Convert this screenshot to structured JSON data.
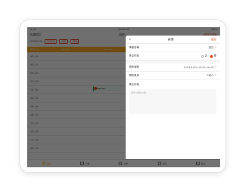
{
  "statusbar": {
    "time": "11:09",
    "date": "Tue Oct 10",
    "battery": "100%"
  },
  "navbar": {
    "left": "店铺首页",
    "title": "场地",
    "right": "+预约",
    "right2": "搜索"
  },
  "toolbar": {
    "date_label": "2023/10/10",
    "chip1": "日/周/月",
    "chip2": "设置",
    "chip3": "更多"
  },
  "grid_header": {
    "col_time": "时间/方式",
    "col_a": "Monday",
    "col_b": "Tuesday"
  },
  "time_slots": [
    "06 : 00",
    "08 : 30",
    "09 : 00",
    "10 : 30",
    "11 : 00",
    "12 : 00",
    "13 : 00",
    "14 : 00",
    "15 : 00",
    "16 : 00",
    "17 : 00",
    "18 : 00"
  ],
  "booking": {
    "label": "MR.LEE"
  },
  "tabs": [
    {
      "label": "首页"
    },
    {
      "label": "订单"
    },
    {
      "label": "会员"
    },
    {
      "label": "扫码"
    },
    {
      "label": "更多"
    }
  ],
  "panel": {
    "title": "新增",
    "confirm": "保存",
    "rows": {
      "field1_label": "場館名稱",
      "field1_value": "館名",
      "field2_label": "是否付款",
      "radio_no": "否",
      "radio_yes": "是",
      "field3_label": "預約時間",
      "field3_value": "2023/10/10  12:00-16:00",
      "field4_label": "預約費用",
      "field4_value": "1個人"
    },
    "remark_label": "備注內容",
    "remark_placeholder": "請輸入備注內容..."
  },
  "colors": {
    "accent": "#f5a623",
    "brand": "#e8502a",
    "booking": "#2e9e4a"
  }
}
